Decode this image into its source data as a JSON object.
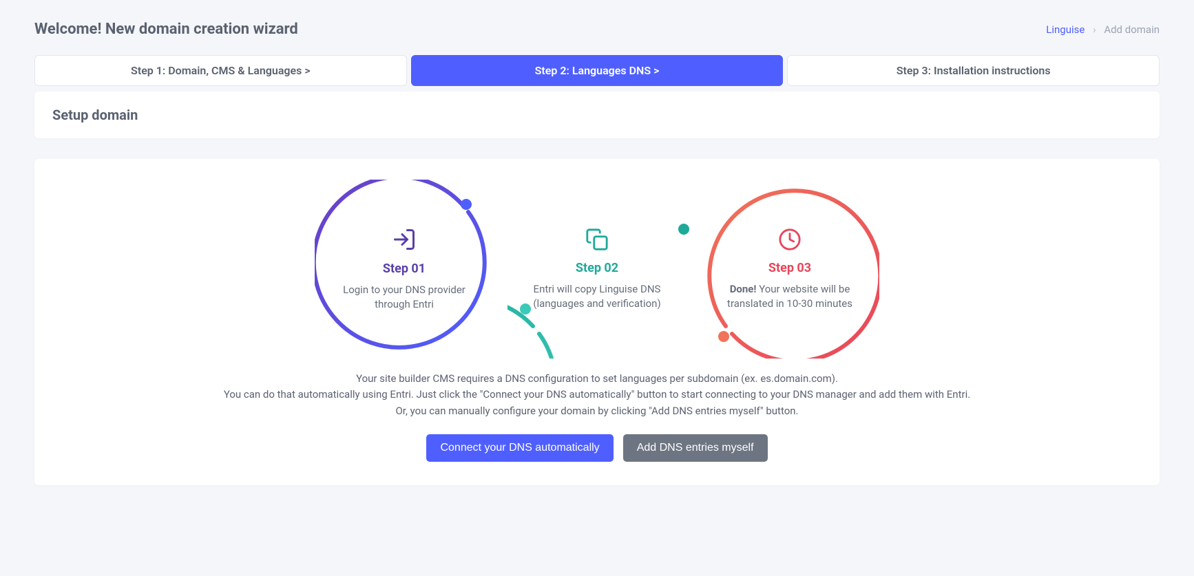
{
  "header": {
    "title": "Welcome! New domain creation wizard",
    "breadcrumb": {
      "root": "Linguise",
      "current": "Add domain"
    }
  },
  "steps": [
    {
      "label": "Step 1: Domain, CMS & Languages  >"
    },
    {
      "label": "Step 2: Languages DNS  >"
    },
    {
      "label": "Step 3: Installation instructions"
    }
  ],
  "panel": {
    "title": "Setup domain"
  },
  "diagram": {
    "step1": {
      "label": "Step 01",
      "desc": "Login to your DNS provider through Entri"
    },
    "step2": {
      "label": "Step 02",
      "desc": "Entri will copy Linguise DNS (languages and verification)"
    },
    "step3": {
      "label": "Step 03",
      "bold": "Done!",
      "rest": " Your website will be translated in 10-30 minutes"
    }
  },
  "description": {
    "line1": "Your site builder CMS requires a DNS configuration to set languages per subdomain (ex. es.domain.com).",
    "line2": "You can do that automatically using Entri. Just click the \"Connect your DNS automatically\" button to start connecting to your DNS manager and add them with Entri.",
    "line3": "Or, you can manually configure your domain by clicking \"Add DNS entries myself\" button."
  },
  "buttons": {
    "primary": "Connect your DNS automatically",
    "secondary": "Add DNS entries myself"
  }
}
